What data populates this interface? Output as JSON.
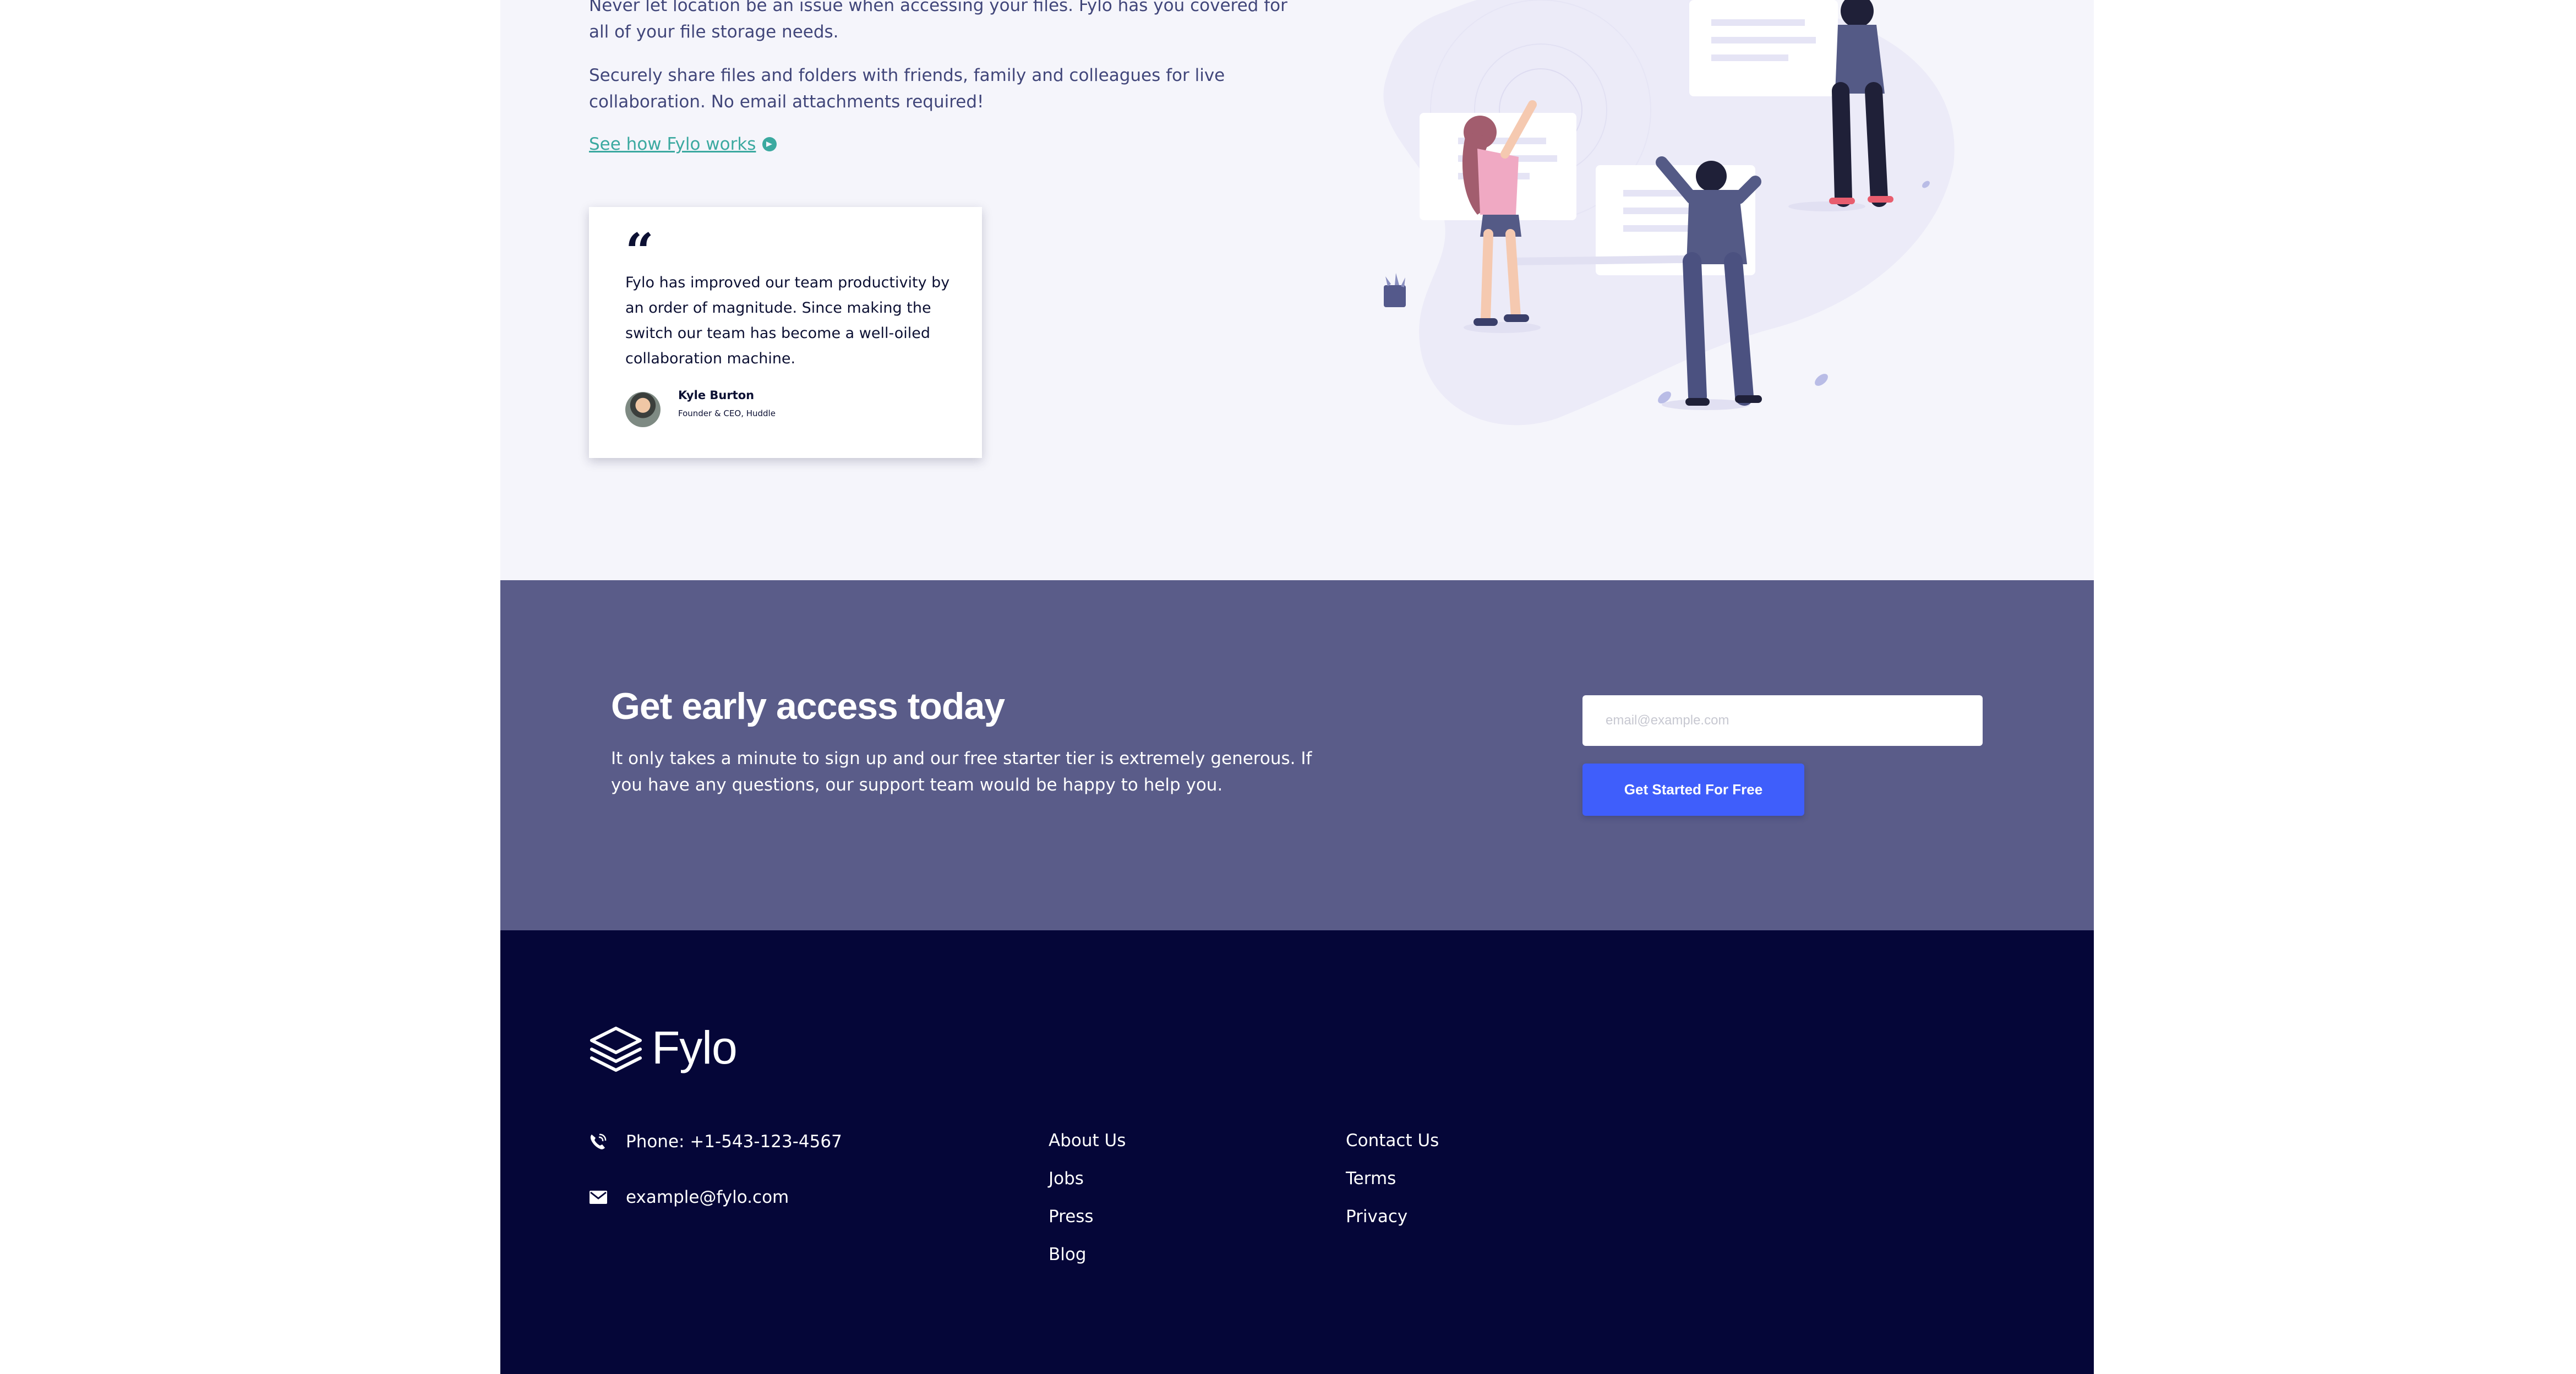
{
  "productive": {
    "paragraph_1": "Never let location be an issue when accessing your files. Fylo has you covered for all of your file storage needs.",
    "paragraph_2": "Securely share files and folders with friends, family and colleagues for live collaboration. No email attachments required!",
    "link_label": "See how Fylo works"
  },
  "testimonial": {
    "quote_mark": "“",
    "text": "Fylo has improved our team productivity by an order of magnitude. Since making the switch our team has become a well-oiled collaboration machine.",
    "author_name": "Kyle Burton",
    "author_role": "Founder & CEO, Huddle"
  },
  "early_access": {
    "title": "Get early access today",
    "description": "It only takes a minute to sign up and our free starter tier is extremely generous. If you have any questions, our support team would be happy to help you.",
    "email_placeholder": "email@example.com",
    "button_label": "Get Started For Free"
  },
  "footer": {
    "logo_text": "Fylo",
    "phone": "Phone: +1-543-123-4567",
    "email": "example@fylo.com",
    "links_col1": [
      "About Us",
      "Jobs",
      "Press",
      "Blog"
    ],
    "links_col2": [
      "Contact Us",
      "Terms",
      "Privacy"
    ]
  },
  "colors": {
    "accent_teal": "#3ba9a0",
    "cta_blue": "#3f5efb",
    "access_bg": "#5a5c89",
    "footer_bg": "#050638"
  }
}
